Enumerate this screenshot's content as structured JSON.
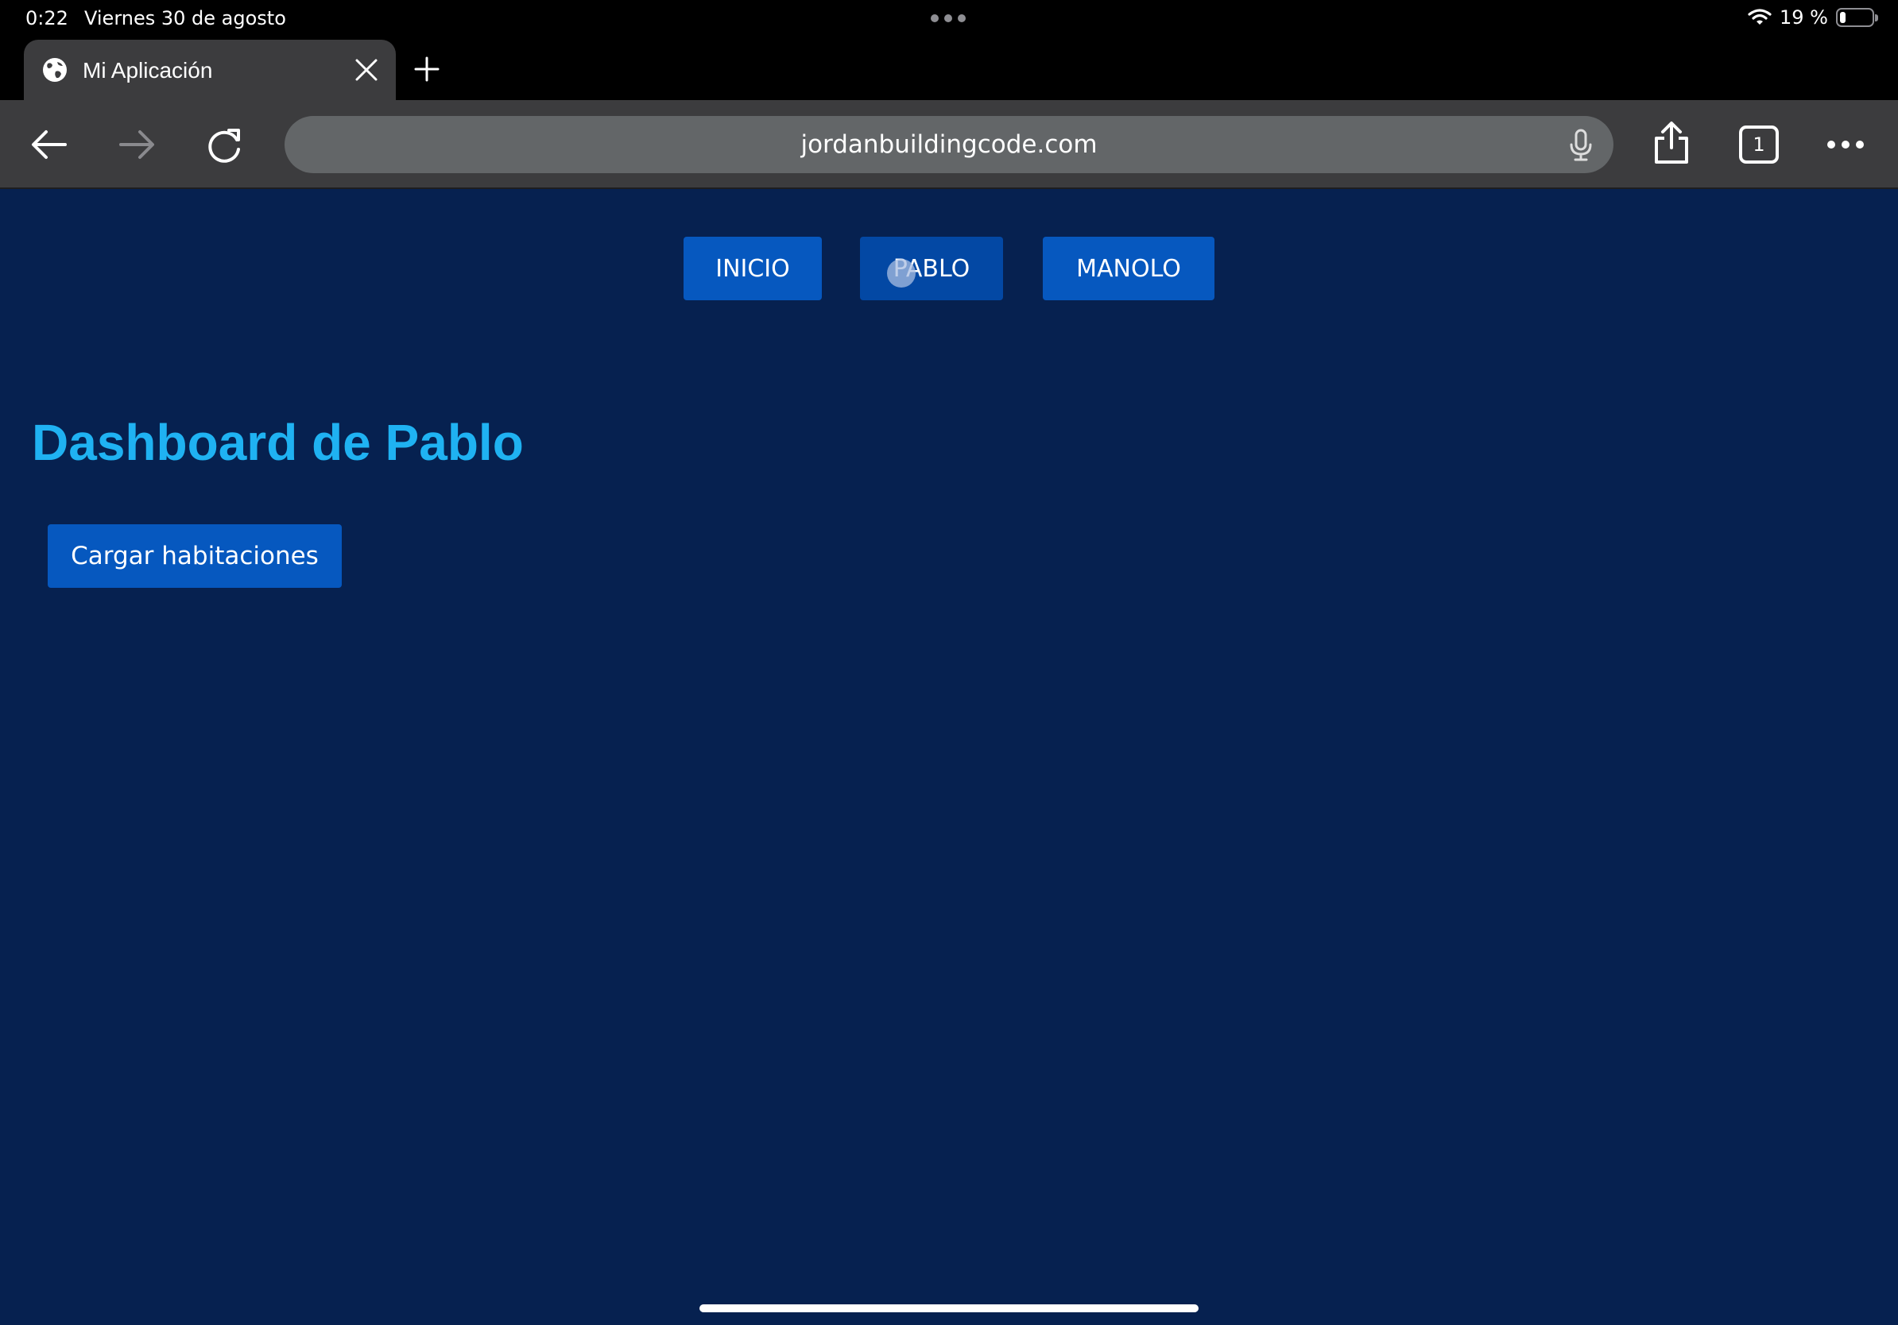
{
  "status_bar": {
    "time": "0:22",
    "date": "Viernes 30 de agosto",
    "battery": "19 %",
    "battery_level": 0.19
  },
  "browser": {
    "tab_title": "Mi Aplicación",
    "url": "jordanbuildingcode.com",
    "tab_count": "1"
  },
  "nav": {
    "items": [
      {
        "label": "INICIO"
      },
      {
        "label": "PABLO",
        "active": true
      },
      {
        "label": "MANOLO"
      }
    ]
  },
  "main": {
    "title": "Dashboard de Pablo",
    "load_button": "Cargar habitaciones"
  },
  "colors": {
    "page_background": "#062150",
    "button": "#0658bf",
    "title": "#1fb2f2",
    "browser_chrome": "#3c3c3e"
  }
}
